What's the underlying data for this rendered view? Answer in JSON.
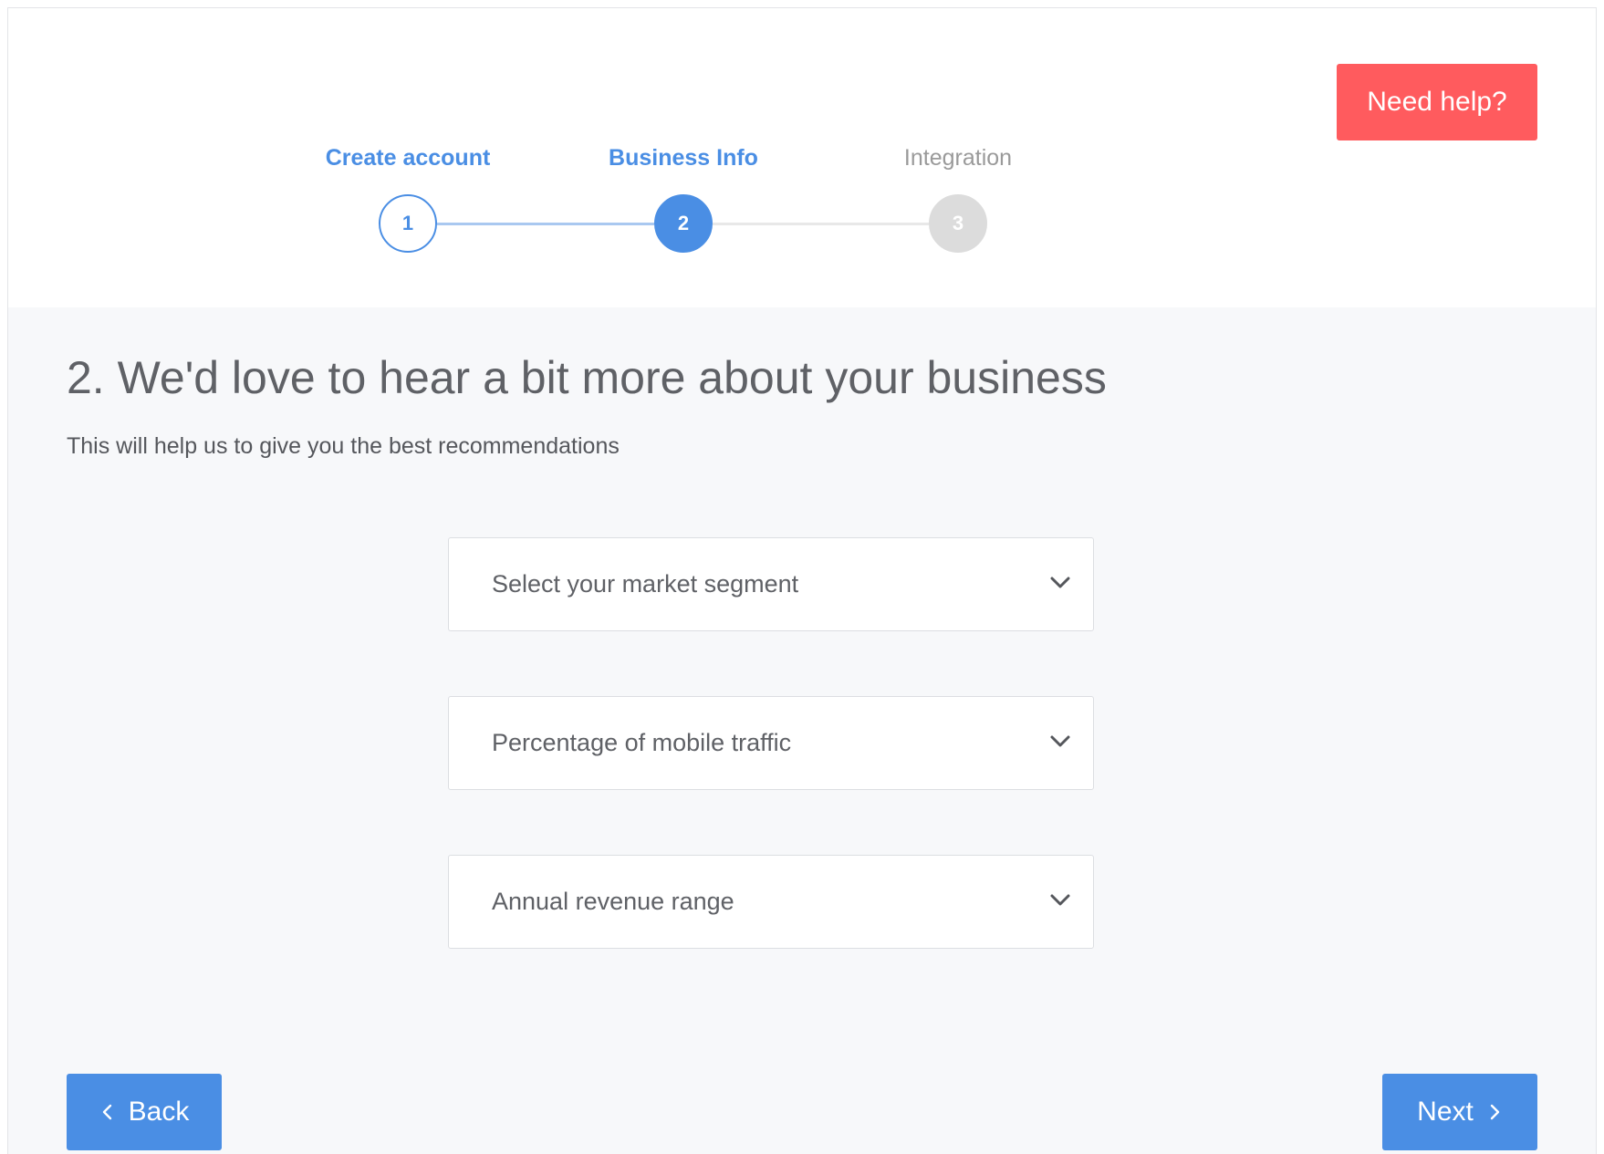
{
  "header": {
    "help_label": "Need help?"
  },
  "stepper": {
    "steps": [
      {
        "number": "1",
        "label": "Create account",
        "state": "done"
      },
      {
        "number": "2",
        "label": "Business Info",
        "state": "active"
      },
      {
        "number": "3",
        "label": "Integration",
        "state": "pending"
      }
    ]
  },
  "main": {
    "title": "2. We'd love to hear a bit more about your business",
    "subtitle": "This will help us to give you the best recommendations",
    "selects": [
      {
        "placeholder": "Select your market segment"
      },
      {
        "placeholder": "Percentage of mobile traffic"
      },
      {
        "placeholder": "Annual revenue range"
      }
    ]
  },
  "footer": {
    "back_label": "Back",
    "next_label": "Next"
  },
  "colors": {
    "accent": "#4a8ee4",
    "help": "#ff5b5e",
    "pending": "#dcdcdc",
    "content_bg": "#f7f8fa"
  },
  "icons": {
    "select": "chevron-down-icon",
    "back": "chevron-left-icon",
    "next": "chevron-right-icon"
  }
}
